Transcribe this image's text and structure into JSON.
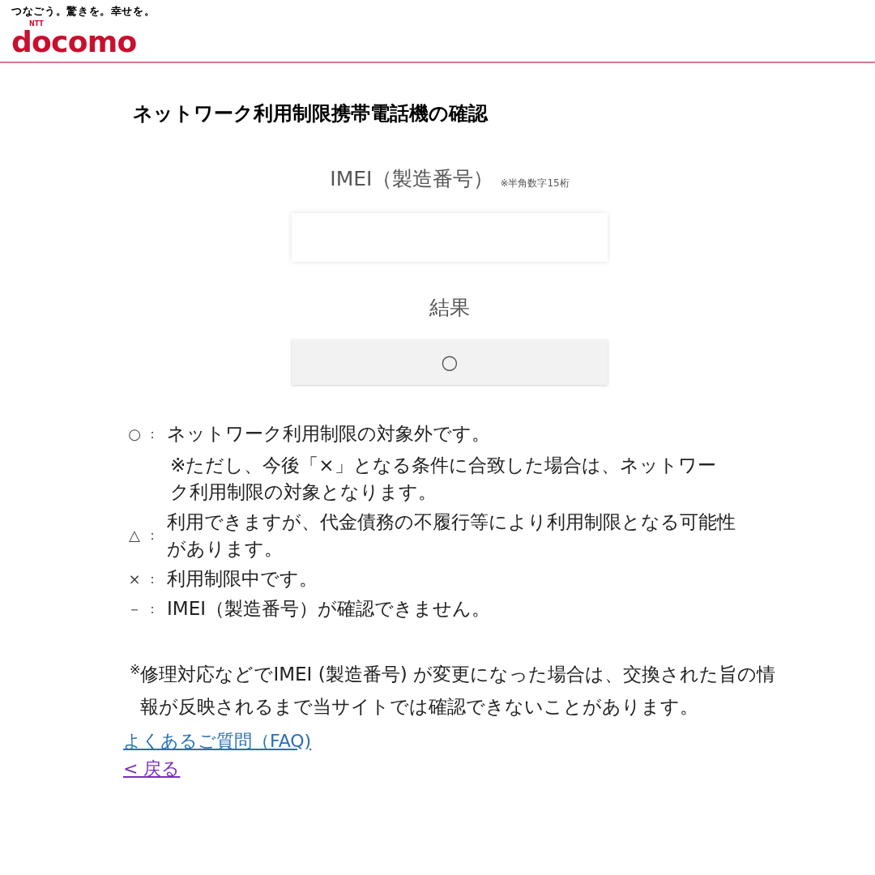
{
  "header": {
    "tagline": "つなごう。驚きを。幸せを。",
    "logo_mark": "NTT",
    "logo": "docomo"
  },
  "title": "ネットワーク利用制限携帯電話機の確認",
  "imei": {
    "label": "IMEI（製造番号）",
    "hint": "※半角数字15桁"
  },
  "result": {
    "label": "結果",
    "value": "○"
  },
  "legend": [
    {
      "symbol": "○",
      "separator": "：",
      "text": "ネットワーク利用制限の対象外です。",
      "note": "※ただし、今後「×」となる条件に合致した場合は、ネットワーク利用制限の対象となります。"
    },
    {
      "symbol": "△",
      "separator": "：",
      "text": "利用できますが、代金債務の不履行等により利用制限となる可能性があります。"
    },
    {
      "symbol": "×",
      "separator": "：",
      "text": "利用制限中です。"
    },
    {
      "symbol": "－",
      "separator": "：",
      "text": "IMEI（製造番号）が確認できません。"
    }
  ],
  "footnote": {
    "mark": "※",
    "text": "修理対応などでIMEI (製造番号) が変更になった場合は、交換された旨の情報が反映されるまで当サイトでは確認できないことがあります。"
  },
  "links": [
    {
      "label": "よくあるご質問（FAQ)",
      "visited": false
    },
    {
      "label": "< 戻る",
      "visited": true
    }
  ]
}
